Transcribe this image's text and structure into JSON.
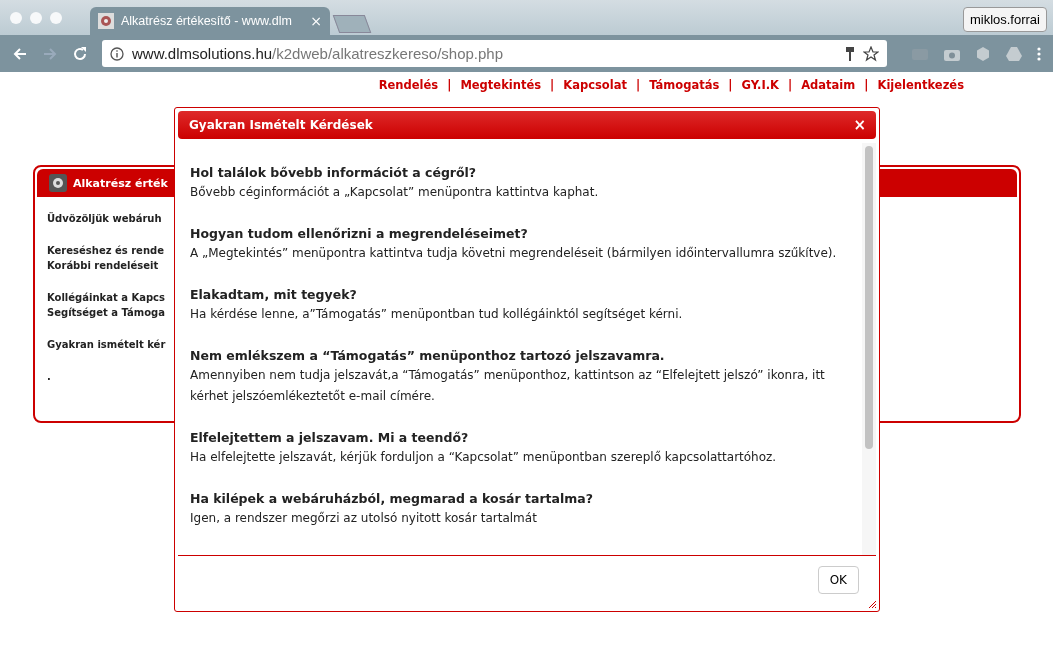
{
  "browser": {
    "tab_title": "Alkatrész értékesítő - www.dlm",
    "tab_close": "×",
    "profile": "miklos.forrai",
    "url_host": "www.dlmsolutions.hu",
    "url_path": "/k2dweb/alkatreszkereso/shop.php"
  },
  "nav": [
    {
      "label": "Rendelés"
    },
    {
      "label": "Megtekintés"
    },
    {
      "label": "Kapcsolat"
    },
    {
      "label": "Támogatás"
    },
    {
      "label": "GY.I.K"
    },
    {
      "label": "Adataim"
    },
    {
      "label": "Kijelentkezés"
    }
  ],
  "nav_separator": "|",
  "card": {
    "title": "Alkatrész érték",
    "paragraphs": [
      [
        "Üdvözöljük webáruh"
      ],
      [
        "Kereséshez és rende",
        "Korábbi rendeléseit"
      ],
      [
        "Kollégáinkat a Kapcs",
        "Segítséget a Támoga"
      ],
      [
        "Gyakran ismételt kér"
      ],
      [
        "."
      ]
    ]
  },
  "dialog": {
    "title": "Gyakran Ismételt Kérdések",
    "close": "×",
    "faq": [
      {
        "question": "Hol találok bővebb információt a cégről?",
        "answer": "Bővebb céginformációt a „Kapcsolat” menüpontra kattintva kaphat."
      },
      {
        "question": "Hogyan tudom ellenőrizni a megrendeléseimet?",
        "answer": "A „Megtekintés” menüpontra kattintva tudja követni megrendeléseit (bármilyen időintervallumra szűkítve)."
      },
      {
        "question": "Elakadtam, mit tegyek?",
        "answer": "Ha kérdése lenne, a”Támogatás” menüpontban tud kollégáinktól segítséget kérni."
      },
      {
        "question": "Nem emlékszem a “Támogatás” menüponthoz tartozó jelszavamra.",
        "answer": "Amennyiben nem tudja jelszavát,a “Támogatás” menüponthoz, kattintson az “Elfelejtett jelszó” ikonra, itt kérhet jelszóemlékeztetőt e-mail címére."
      },
      {
        "question": "Elfelejtettem a jelszavam. Mi a teendő?",
        "answer": "Ha elfelejtette jelszavát, kérjük forduljon a “Kapcsolat” menüpontban szereplő kapcsolattartóhoz."
      },
      {
        "question": "Ha kilépek a webáruházból, megmarad a kosár tartalma?",
        "answer": "Igen, a rendszer megőrzi az utolsó nyitott kosár tartalmát"
      }
    ],
    "ok_button": "OK"
  }
}
